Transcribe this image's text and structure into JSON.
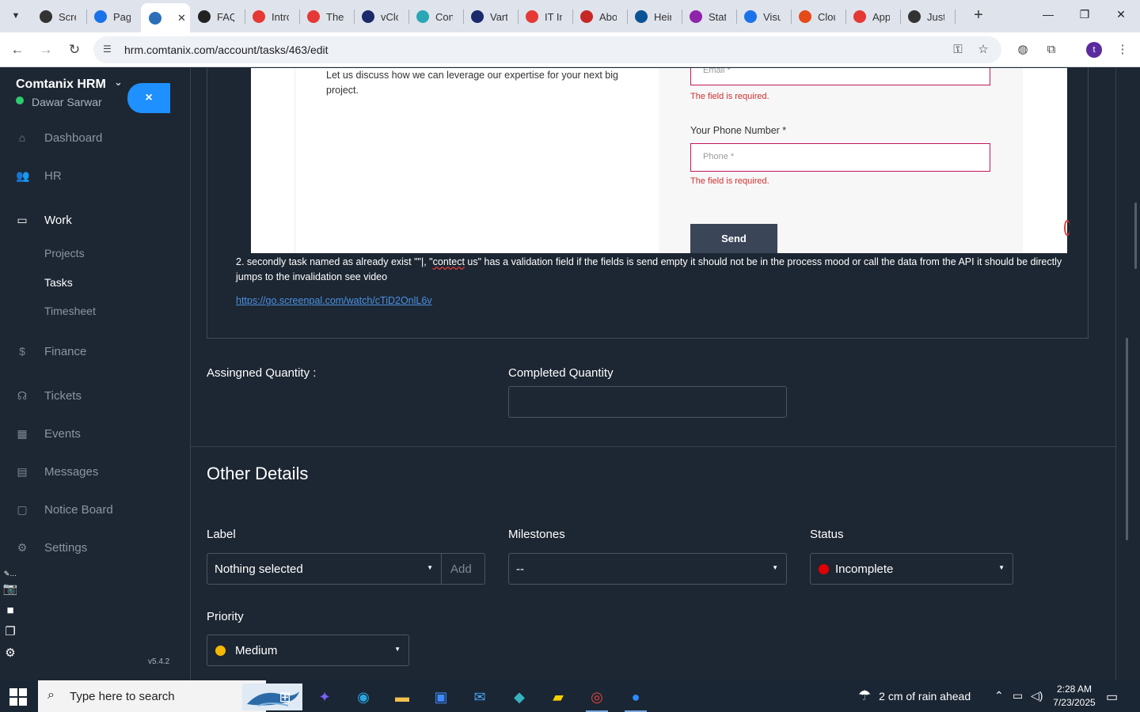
{
  "browser": {
    "tabs": [
      {
        "title": "Scre",
        "color": "#333333"
      },
      {
        "title": "Pag",
        "color": "#1a73e8"
      },
      {
        "title": "",
        "color": "#2c6fb7",
        "active": true
      },
      {
        "title": "FAQ",
        "color": "#222222"
      },
      {
        "title": "Intro",
        "color": "#e53935"
      },
      {
        "title": "The",
        "color": "#e53935"
      },
      {
        "title": "vClo",
        "color": "#1b2a6b"
      },
      {
        "title": "Con",
        "color": "#2ba6b5"
      },
      {
        "title": "Vart",
        "color": "#1b2a6b"
      },
      {
        "title": "IT In",
        "color": "#e53935"
      },
      {
        "title": "Abo",
        "color": "#c62828"
      },
      {
        "title": "Heir",
        "color": "#0b5394"
      },
      {
        "title": "Stat",
        "color": "#8e24aa"
      },
      {
        "title": "Visu",
        "color": "#1a73e8"
      },
      {
        "title": "Clou",
        "color": "#e64a19"
      },
      {
        "title": "App",
        "color": "#e53935"
      },
      {
        "title": "Just",
        "color": "#333333"
      }
    ],
    "url": "hrm.comtanix.com/account/tasks/463/edit",
    "profile_initial": "t"
  },
  "sidebar": {
    "brand": "Comtanix HRM",
    "user": "Dawar Sarwar",
    "close_label": "×",
    "nav": [
      {
        "label": "Dashboard",
        "icon": "home-icon"
      },
      {
        "label": "HR",
        "icon": "users-icon"
      },
      {
        "label": "Work",
        "icon": "briefcase-icon"
      },
      {
        "label": "Finance",
        "icon": "dollar-icon"
      },
      {
        "label": "Tickets",
        "icon": "headset-icon"
      },
      {
        "label": "Events",
        "icon": "calendar-icon"
      },
      {
        "label": "Messages",
        "icon": "message-icon"
      },
      {
        "label": "Notice Board",
        "icon": "clipboard-icon"
      },
      {
        "label": "Settings",
        "icon": "gear-icon"
      }
    ],
    "work_sub": [
      {
        "label": "Projects"
      },
      {
        "label": "Tasks",
        "active": true
      },
      {
        "label": "Timesheet"
      }
    ],
    "version": "v5.4.2"
  },
  "task": {
    "embed": {
      "intro_text": "Let us discuss how we can leverage our expertise for your next big project.",
      "email_placeholder": "Email *",
      "required_msg": "The field is required.",
      "phone_label": "Your Phone Number *",
      "phone_placeholder": "Phone *",
      "send_label": "Send"
    },
    "description_pre": "2. secondly task named as already exist \"\"|, \"",
    "description_misspelled": "contect",
    "description_post": " us\" has a validation field if the fields is send empty it should not be in the process mood or call the data from the API it should be directly jumps to the invalidation see video",
    "video_link": "https://go.screenpal.com/watch/cTiD2OnlL6v",
    "assigned_quantity_label": "Assingned Quantity :",
    "completed_quantity_label": "Completed Quantity",
    "completed_quantity_value": ""
  },
  "other_details": {
    "title": "Other Details",
    "label_field": {
      "label": "Label",
      "value": "Nothing selected",
      "add": "Add"
    },
    "milestones": {
      "label": "Milestones",
      "value": "--"
    },
    "status": {
      "label": "Status",
      "value": "Incomplete",
      "color": "#e00000"
    },
    "priority": {
      "label": "Priority",
      "value": "Medium",
      "color": "#f5b800"
    }
  },
  "taskbar": {
    "search_placeholder": "Type here to search",
    "weather": "2 cm of rain ahead",
    "time": "2:28 AM",
    "date": "7/23/2025"
  }
}
